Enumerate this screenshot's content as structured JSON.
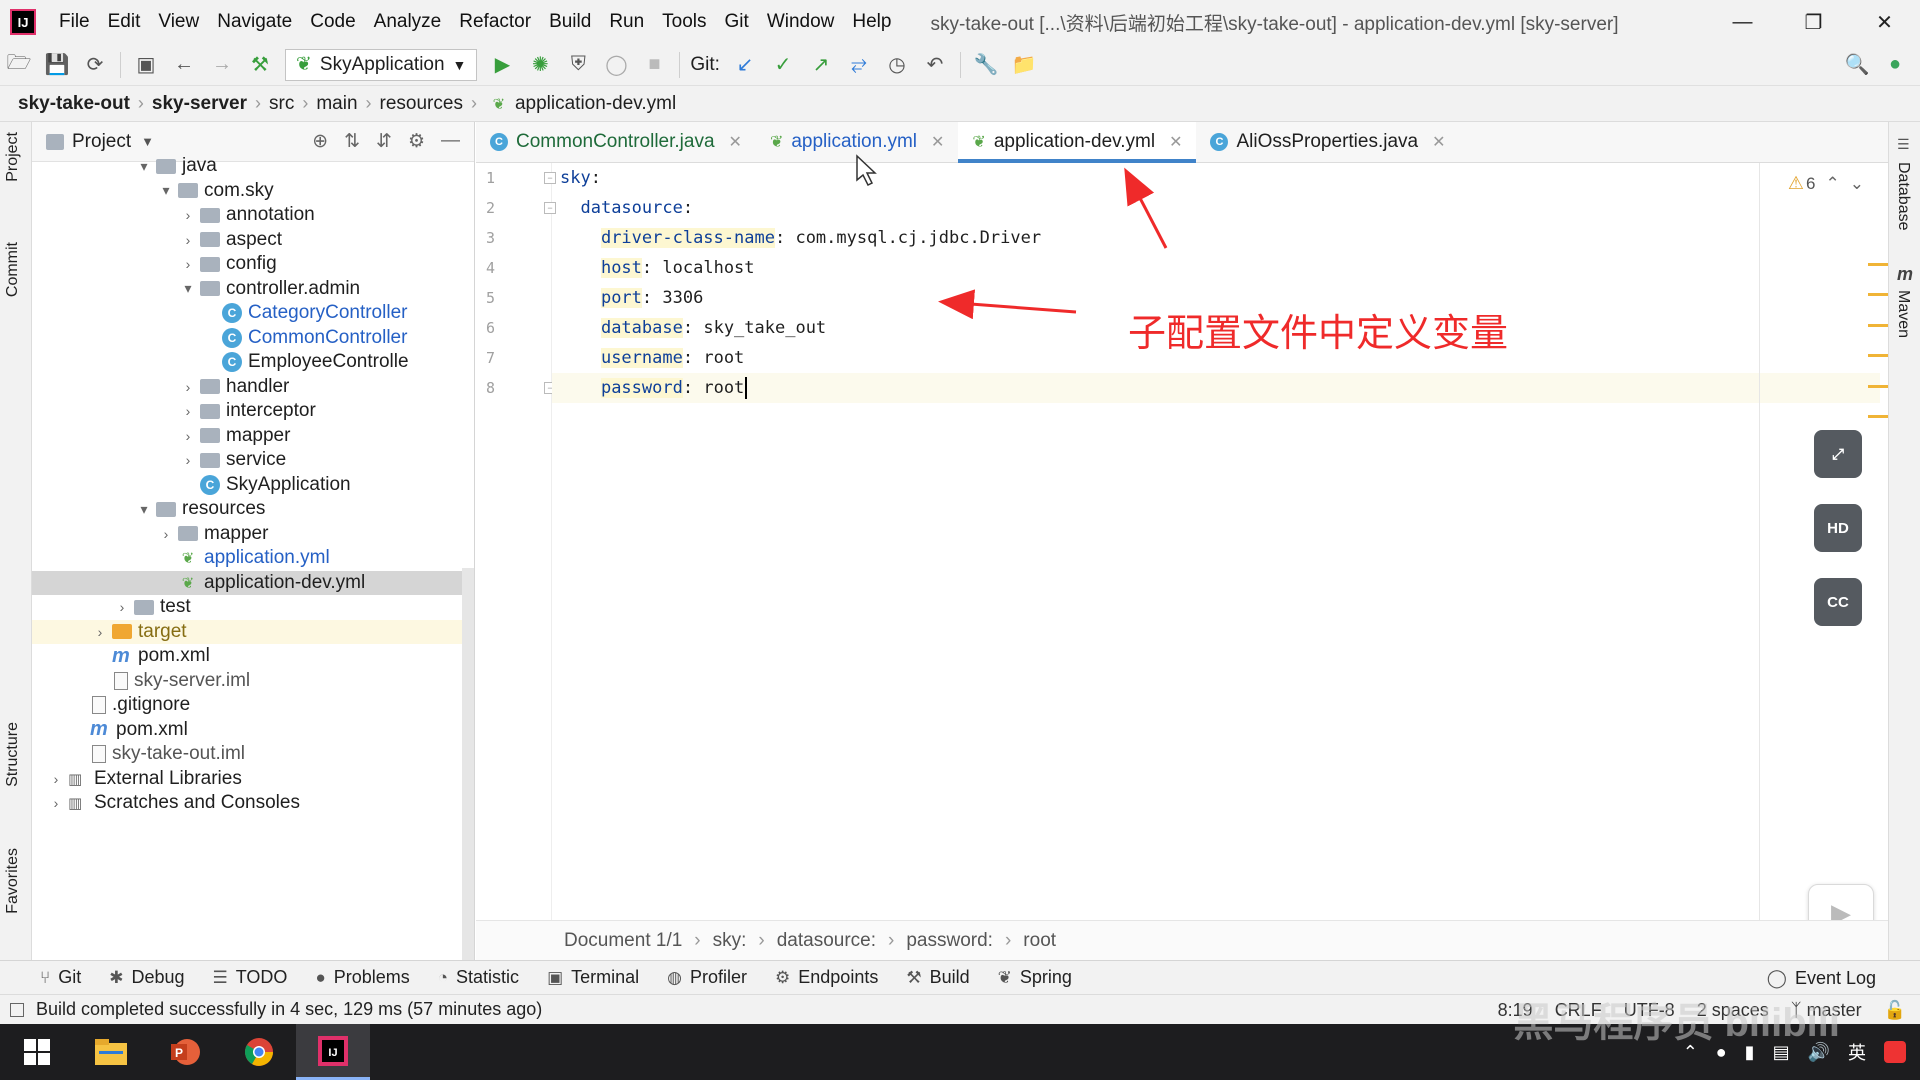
{
  "menu": [
    "File",
    "Edit",
    "View",
    "Navigate",
    "Code",
    "Analyze",
    "Refactor",
    "Build",
    "Run",
    "Tools",
    "Git",
    "Window",
    "Help"
  ],
  "window_title": "sky-take-out [...\\资料\\后端初始工程\\sky-take-out] - application-dev.yml [sky-server]",
  "window_controls": [
    "—",
    "❐",
    "✕"
  ],
  "toolbar": {
    "run_config": "SkyApplication",
    "git_label": "Git:"
  },
  "breadcrumb": [
    "sky-take-out",
    "sky-server",
    "src",
    "main",
    "resources",
    "application-dev.yml"
  ],
  "left_tabs": [
    "Project",
    "Commit",
    "Structure",
    "Favorites"
  ],
  "right_tabs": [
    "Database",
    "Maven"
  ],
  "project_panel": {
    "title": "Project",
    "tree": [
      {
        "label": "java",
        "type": "folder",
        "depth": 5,
        "arrow": "▾"
      },
      {
        "label": "com.sky",
        "type": "folder",
        "depth": 6,
        "arrow": "▾"
      },
      {
        "label": "annotation",
        "type": "folder",
        "depth": 7,
        "arrow": "›"
      },
      {
        "label": "aspect",
        "type": "folder",
        "depth": 7,
        "arrow": "›"
      },
      {
        "label": "config",
        "type": "folder",
        "depth": 7,
        "arrow": "›"
      },
      {
        "label": "controller.admin",
        "type": "folder",
        "depth": 7,
        "arrow": "▾"
      },
      {
        "label": "CategoryController",
        "type": "class",
        "depth": 8,
        "color": "blue"
      },
      {
        "label": "CommonController",
        "type": "class",
        "depth": 8,
        "color": "blue"
      },
      {
        "label": "EmployeeControlle",
        "type": "class",
        "depth": 8
      },
      {
        "label": "handler",
        "type": "folder",
        "depth": 7,
        "arrow": "›"
      },
      {
        "label": "interceptor",
        "type": "folder",
        "depth": 7,
        "arrow": "›"
      },
      {
        "label": "mapper",
        "type": "folder",
        "depth": 7,
        "arrow": "›"
      },
      {
        "label": "service",
        "type": "folder",
        "depth": 7,
        "arrow": "›"
      },
      {
        "label": "SkyApplication",
        "type": "spring",
        "depth": 7
      },
      {
        "label": "resources",
        "type": "folder",
        "depth": 5,
        "arrow": "▾"
      },
      {
        "label": "mapper",
        "type": "folder",
        "depth": 6,
        "arrow": "›"
      },
      {
        "label": "application.yml",
        "type": "yml",
        "depth": 6,
        "color": "blue"
      },
      {
        "label": "application-dev.yml",
        "type": "yml",
        "depth": 6,
        "selected": true
      },
      {
        "label": "test",
        "type": "folder",
        "depth": 4,
        "arrow": "›"
      },
      {
        "label": "target",
        "type": "folder-orange",
        "depth": 3,
        "arrow": "›",
        "color": "olive",
        "highlight": true
      },
      {
        "label": "pom.xml",
        "type": "maven",
        "depth": 3
      },
      {
        "label": "sky-server.iml",
        "type": "file",
        "depth": 3,
        "color": "gray"
      },
      {
        "label": ".gitignore",
        "type": "file",
        "depth": 2
      },
      {
        "label": "pom.xml",
        "type": "maven",
        "depth": 2
      },
      {
        "label": "sky-take-out.iml",
        "type": "file",
        "depth": 2,
        "color": "gray"
      },
      {
        "label": "External Libraries",
        "type": "lib",
        "depth": 1,
        "arrow": "›"
      },
      {
        "label": "Scratches and Consoles",
        "type": "lib",
        "depth": 1,
        "arrow": "›"
      }
    ]
  },
  "editor_tabs": [
    {
      "label": "CommonController.java",
      "icon": "C",
      "color": "#1f6b3a"
    },
    {
      "label": "application.yml",
      "icon": "yml",
      "color": "#2560c5"
    },
    {
      "label": "application-dev.yml",
      "icon": "yml",
      "active": true,
      "color": "#1f1f1f"
    },
    {
      "label": "AliOssProperties.java",
      "icon": "C",
      "color": "#1f1f1f"
    }
  ],
  "code_lines": [
    {
      "num": "1",
      "indent": 0,
      "key": "sky",
      "value": ""
    },
    {
      "num": "2",
      "indent": 2,
      "key": "datasource",
      "value": ""
    },
    {
      "num": "3",
      "indent": 4,
      "key": "driver-class-name",
      "value": "com.mysql.cj.jdbc.Driver"
    },
    {
      "num": "4",
      "indent": 4,
      "key": "host",
      "value": "localhost"
    },
    {
      "num": "5",
      "indent": 4,
      "key": "port",
      "value": "3306"
    },
    {
      "num": "6",
      "indent": 4,
      "key": "database",
      "value": "sky_take_out"
    },
    {
      "num": "7",
      "indent": 4,
      "key": "username",
      "value": "root"
    },
    {
      "num": "8",
      "indent": 4,
      "key": "password",
      "value": "root",
      "current": true
    }
  ],
  "warnings": "6",
  "annotation_text": "子配置文件中定义变量",
  "floating_buttons": [
    "⤢",
    "HD",
    "CC"
  ],
  "editor_breadcrumb": [
    "Document 1/1",
    "sky:",
    "datasource:",
    "password:",
    "root"
  ],
  "tool_tabs": [
    {
      "label": "Git",
      "icon": "⑂"
    },
    {
      "label": "Debug",
      "icon": "✱"
    },
    {
      "label": "TODO",
      "icon": "☰"
    },
    {
      "label": "Problems",
      "icon": "●"
    },
    {
      "label": "Statistic",
      "icon": "◔"
    },
    {
      "label": "Terminal",
      "icon": "▣"
    },
    {
      "label": "Profiler",
      "icon": "◍"
    },
    {
      "label": "Endpoints",
      "icon": "⚙"
    },
    {
      "label": "Build",
      "icon": "⚒"
    },
    {
      "label": "Spring",
      "icon": "❦"
    }
  ],
  "event_log": "Event Log",
  "status": {
    "message": "Build completed successfully in 4 sec, 129 ms (57 minutes ago)",
    "position": "8:19",
    "line_sep": "CRLF",
    "encoding": "UTF-8",
    "indent": "2 spaces",
    "branch": "master"
  },
  "tray": {
    "ime": "英"
  },
  "watermark": "黑马程序员 bilibili"
}
